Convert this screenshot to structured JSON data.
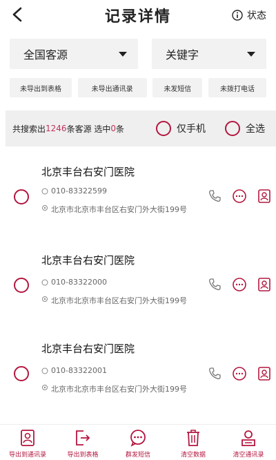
{
  "header": {
    "title": "记录详情",
    "status_label": "状态"
  },
  "filters": {
    "source_value": "全国客源",
    "keyword_value": "关键字"
  },
  "actions": [
    {
      "label": "未导出到表格"
    },
    {
      "label": "未导出通讯录"
    },
    {
      "label": "未发短信"
    },
    {
      "label": "未拨打电话"
    }
  ],
  "summary": {
    "prefix": "共搜索出",
    "count": "1246",
    "mid": "条客源  选中",
    "selected": "0",
    "suffix": "条",
    "only_phone": "仅手机",
    "select_all": "全选"
  },
  "records": [
    {
      "name": "北京丰台右安门医院",
      "phone": "010-83322599",
      "address": "北京市北京市丰台区右安门外大街199号"
    },
    {
      "name": "北京丰台右安门医院",
      "phone": "010-83322000",
      "address": "北京市北京市丰台区右安门外大街199号"
    },
    {
      "name": "北京丰台右安门医院",
      "phone": "010-83322001",
      "address": "北京市北京市丰台区右安门外大街199号"
    }
  ],
  "bottom_bar": [
    {
      "label": "导出到通讯录",
      "icon": "contact-card-icon"
    },
    {
      "label": "导出到表格",
      "icon": "export-icon"
    },
    {
      "label": "群发短信",
      "icon": "message-icon"
    },
    {
      "label": "清空数据",
      "icon": "trash-icon"
    },
    {
      "label": "清空通讯录",
      "icon": "clear-contacts-icon"
    }
  ],
  "colors": {
    "accent": "#b3163f",
    "count": "#c0335a",
    "panel": "#f2f2f2"
  }
}
